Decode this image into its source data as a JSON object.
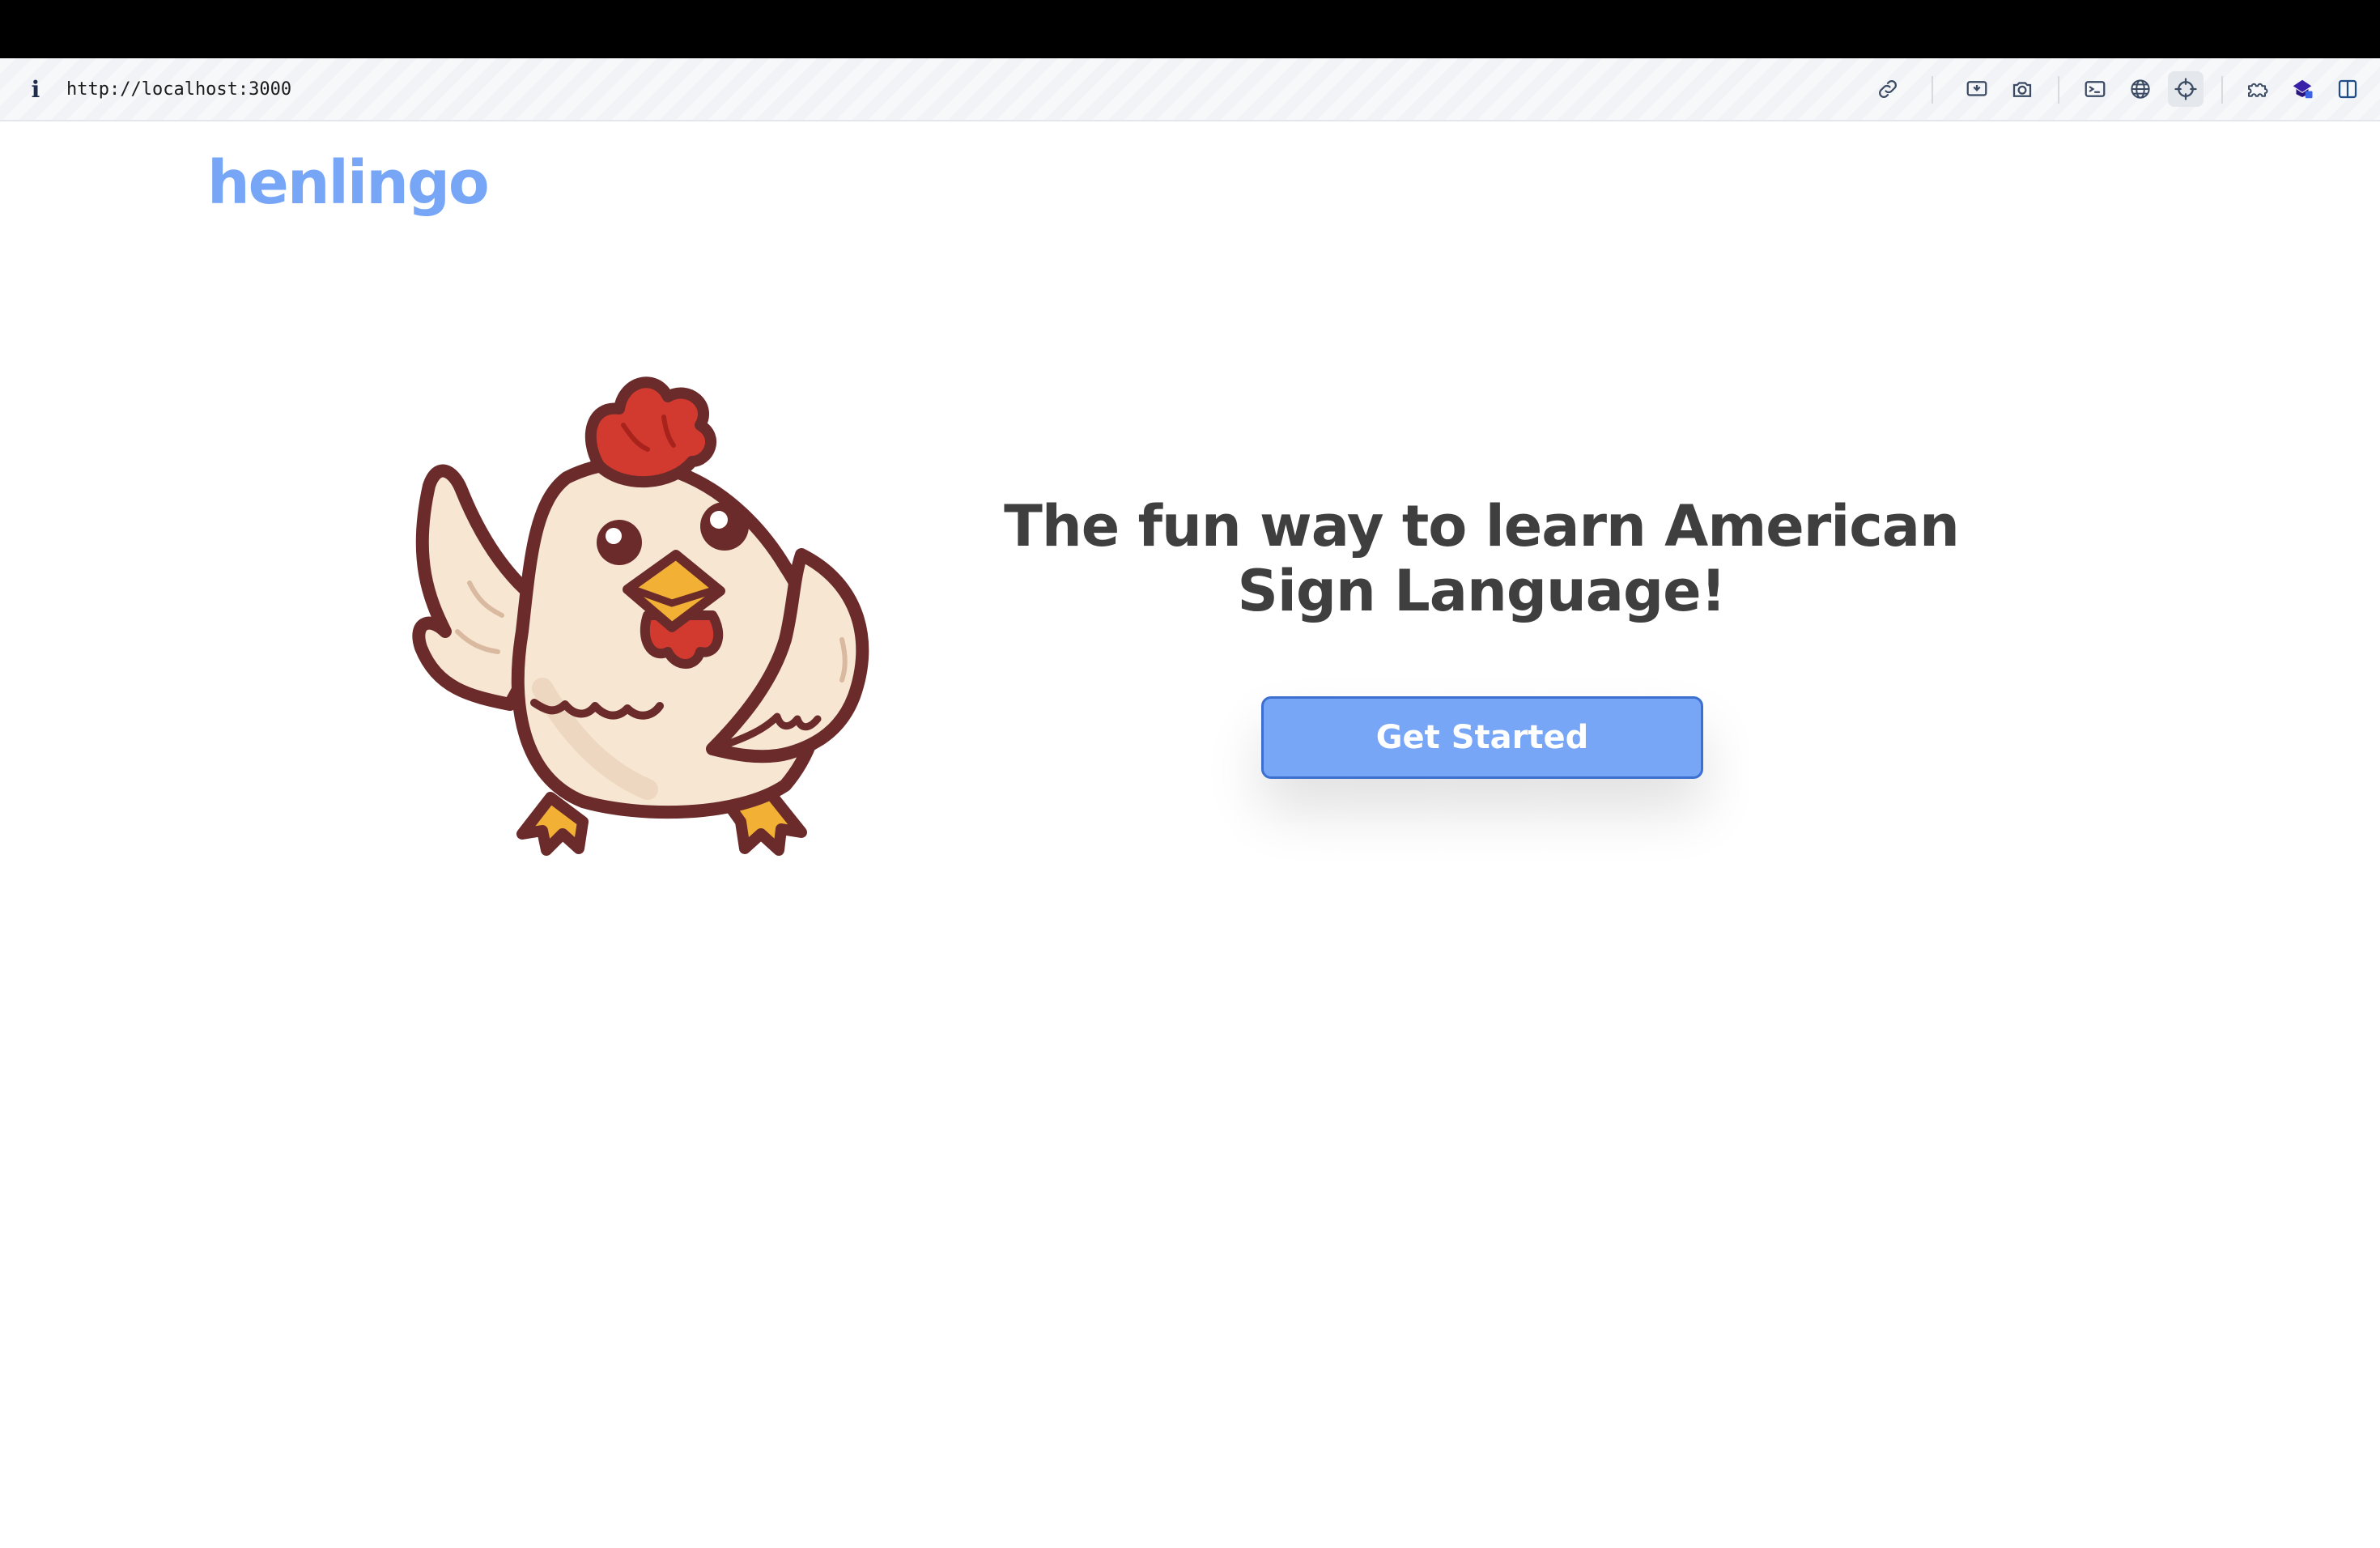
{
  "browser": {
    "url": "http://localhost:3000",
    "icons": [
      "link-icon",
      "screen-capture-icon",
      "camera-icon",
      "terminal-icon",
      "globe-icon",
      "crosshair-icon",
      "extensions-icon",
      "extension-badge-icon",
      "split-view-icon"
    ]
  },
  "app": {
    "logo": "henlingo",
    "mascot": "chicken-mascot",
    "headline": "The fun way to learn American Sign Language!",
    "cta_label": "Get Started"
  },
  "colors": {
    "brand": "#77a6f7",
    "button_border": "#3d6fd1",
    "headline_text": "#3f3f3f",
    "mascot_outline": "#6b2b2b",
    "mascot_body": "#f7e6d2",
    "comb_red": "#d33a2f",
    "beak_orange": "#f2b134"
  }
}
